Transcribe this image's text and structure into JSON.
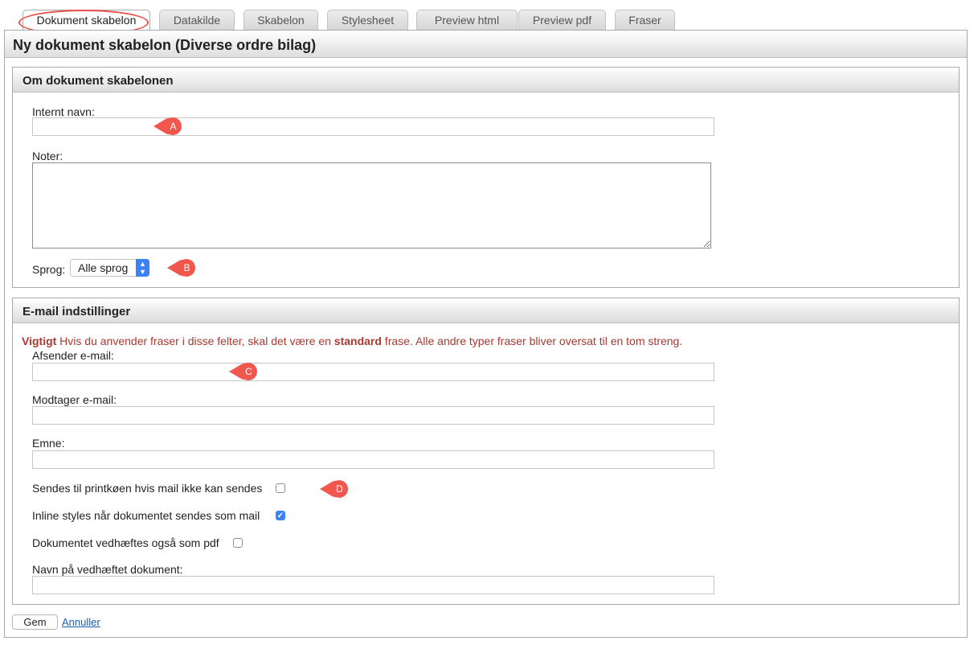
{
  "tabs": [
    "Dokument skabelon",
    "Datakilde",
    "Skabelon",
    "Stylesheet",
    "Preview html",
    "Preview pdf",
    "Fraser"
  ],
  "page_title": "Ny dokument skabelon (Diverse ordre bilag)",
  "section_about": {
    "title": "Om dokument skabelonen",
    "internal_name_label": "Internt navn:",
    "internal_name_value": "",
    "notes_label": "Noter:",
    "notes_value": "",
    "language_label": "Sprog:",
    "language_value": "Alle sprog"
  },
  "section_email": {
    "title": "E-mail indstillinger",
    "warning_strong": "Vigtigt",
    "warning_text_1": " Hvis du anvender fraser i disse felter, skal det være en ",
    "warning_emphasis": "standard",
    "warning_text_2": " frase. Alle andre typer fraser bliver oversat til en tom streng.",
    "sender_label": "Afsender e-mail:",
    "sender_value": "",
    "recipient_label": "Modtager e-mail:",
    "recipient_value": "",
    "subject_label": "Emne:",
    "subject_value": "",
    "print_queue_label": "Sendes til printkøen hvis mail ikke kan sendes",
    "print_queue_checked": false,
    "inline_styles_label": "Inline styles når dokumentet sendes som mail",
    "inline_styles_checked": true,
    "attach_pdf_label": "Dokumentet vedhæftes også som pdf",
    "attach_pdf_checked": false,
    "attachment_name_label": "Navn på vedhæftet dokument:",
    "attachment_name_value": ""
  },
  "annotations": [
    "A",
    "B",
    "C",
    "D"
  ],
  "actions": {
    "save_label": "Gem",
    "cancel_label": "Annuller"
  },
  "colors": {
    "annotation": "#f2574d",
    "checkbox_accent": "#3b82f6",
    "warning_text": "#a83a32",
    "link": "#1a5bb8"
  }
}
